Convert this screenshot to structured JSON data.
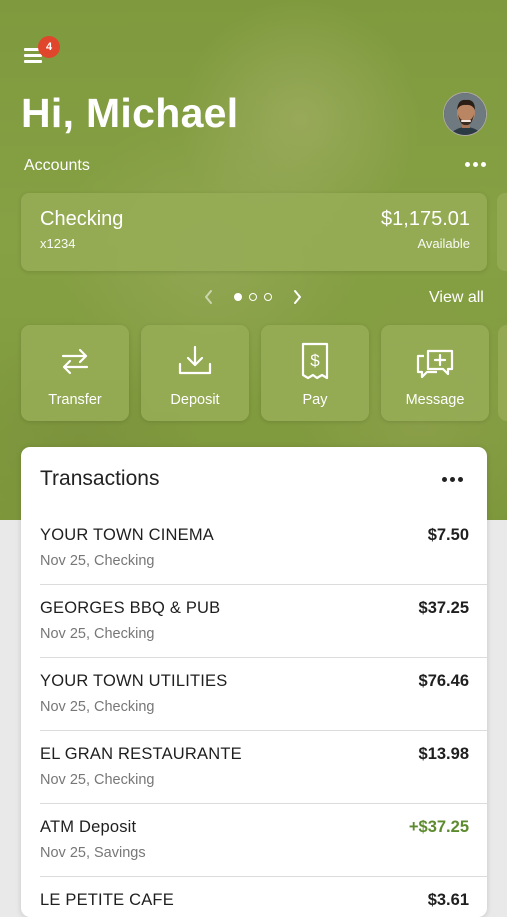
{
  "header": {
    "notification_count": "4",
    "greeting": "Hi, Michael",
    "accounts_label": "Accounts"
  },
  "account": {
    "name": "Checking",
    "number": "x1234",
    "balance": "$1,175.01",
    "balance_label": "Available"
  },
  "carousel": {
    "page_count": 3,
    "active_page": 1,
    "view_all_label": "View all"
  },
  "actions": [
    {
      "label": "Transfer",
      "icon": "transfer-arrows-icon"
    },
    {
      "label": "Deposit",
      "icon": "deposit-download-icon"
    },
    {
      "label": "Pay",
      "icon": "pay-bill-icon"
    },
    {
      "label": "Message",
      "icon": "message-plus-icon"
    }
  ],
  "transactions": {
    "title": "Transactions",
    "items": [
      {
        "name": "YOUR TOWN CINEMA",
        "detail": "Nov 25, Checking",
        "amount": "$7.50"
      },
      {
        "name": "GEORGES BBQ & PUB",
        "detail": "Nov 25, Checking",
        "amount": "$37.25"
      },
      {
        "name": "YOUR TOWN UTILITIES",
        "detail": "Nov 25, Checking",
        "amount": "$76.46"
      },
      {
        "name": "EL GRAN RESTAURANTE",
        "detail": "Nov 25, Checking",
        "amount": "$13.98"
      },
      {
        "name": "ATM Deposit",
        "detail": "Nov 25, Savings",
        "amount": "+$37.25"
      },
      {
        "name": "LE PETITE CAFE",
        "detail": "",
        "amount": "$3.61"
      }
    ]
  },
  "colors": {
    "brand_green": "#86a044",
    "badge_red": "#e0462c",
    "credit_green": "#5d8b2f"
  }
}
